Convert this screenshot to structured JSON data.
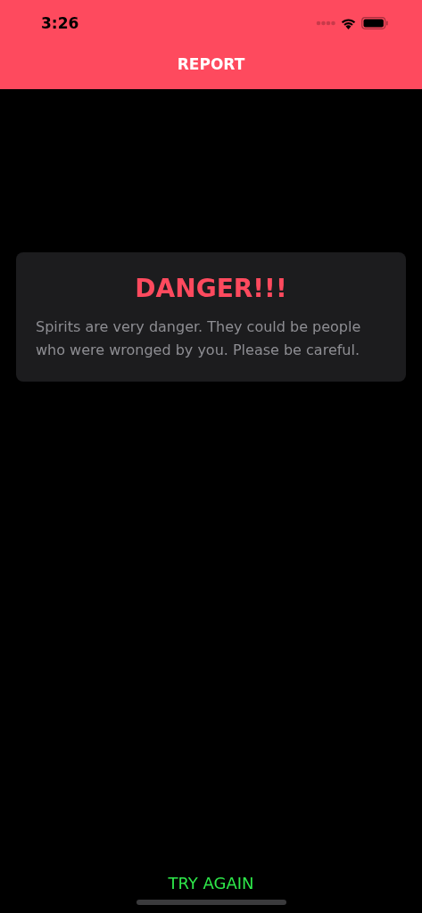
{
  "status_bar": {
    "time": "3:26"
  },
  "nav": {
    "title": "REPORT"
  },
  "card": {
    "title": "DANGER!!!",
    "message": "Spirits are very danger. They could be people who were wronged by you. Please be careful."
  },
  "footer": {
    "button": "TRY AGAIN"
  }
}
